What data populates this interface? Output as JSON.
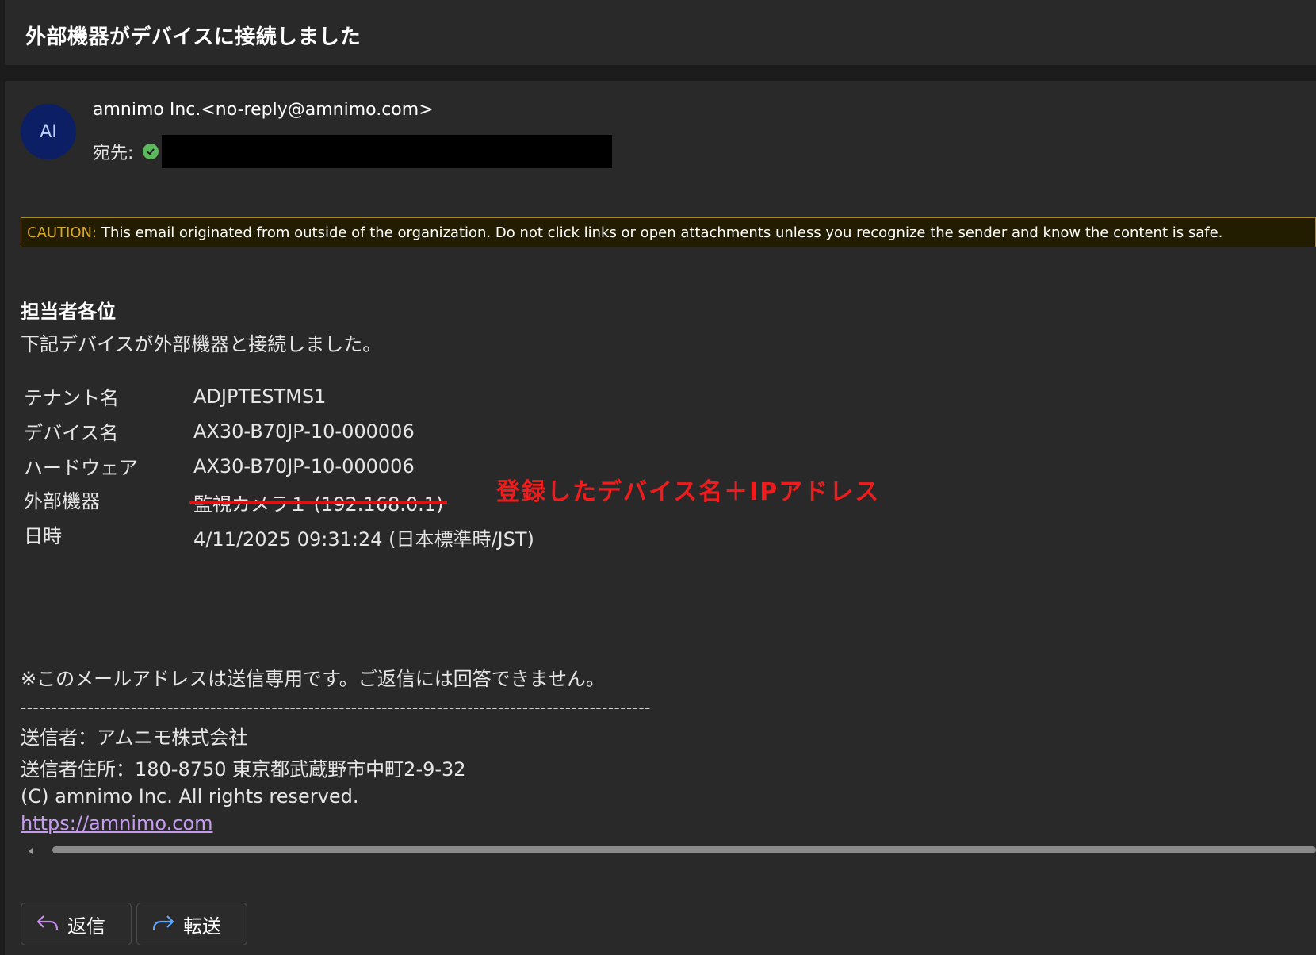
{
  "email": {
    "subject": "外部機器がデバイスに接続しました",
    "avatar_initials": "AI",
    "sender": "amnimo Inc.<no-reply@amnimo.com>",
    "to_label": "宛先:"
  },
  "caution": {
    "label": "CAUTION:",
    "text": "This email originated from outside of the organization. Do not click links or open attachments unless you recognize the sender and know the content is safe."
  },
  "body": {
    "greeting": "担当者各位",
    "intro": "下記デバイスが外部機器と接続しました。",
    "info": [
      {
        "label": "テナント名",
        "value": "ADJPTESTMS1"
      },
      {
        "label": "デバイス名",
        "value": "AX30-B70JP-10-000006"
      },
      {
        "label": "ハードウェア",
        "value": "AX30-B70JP-10-000006"
      },
      {
        "label": "外部機器",
        "value": "監視カメラ１ (192.168.0.1)"
      },
      {
        "label": "日時",
        "value": "4/11/2025 09:31:24 (日本標準時/JST)"
      }
    ],
    "annotation": "登録したデバイス名＋IPアドレス",
    "note": "※このメールアドレスは送信専用です。ご返信には回答できません。",
    "separator": "-------------------------------------------------------------------------------------------------------",
    "footer_sender": "送信者：アムニモ株式会社",
    "footer_address": "送信者住所：180-8750 東京都武蔵野市中町2-9-32",
    "footer_copyright": "(C) amnimo Inc. All rights reserved.",
    "link": "https://amnimo.com"
  },
  "actions": {
    "reply_label": "返信",
    "forward_label": "転送"
  },
  "colors": {
    "background": "#292929",
    "accent_annotation": "#ee1c1c",
    "caution_border": "#a88a22",
    "link": "#c79cf0",
    "avatar_bg": "#0c1f64"
  }
}
